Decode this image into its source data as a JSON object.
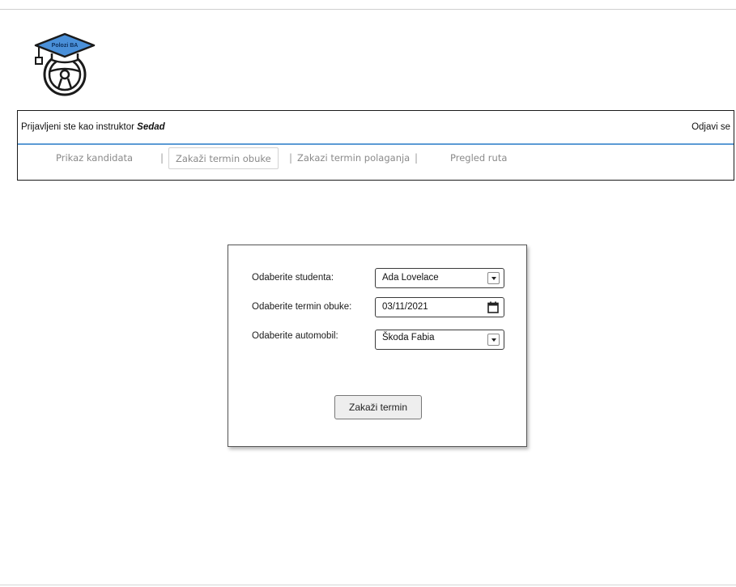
{
  "logo": {
    "badge_text": "Polozi BA",
    "icon": "graduation-cap-steering-wheel-icon"
  },
  "header": {
    "user_prefix": "Prijavljeni ste kao instruktor ",
    "user_name": "Sedad",
    "logout_label": "Odjavi se"
  },
  "nav": {
    "items": [
      {
        "label": "Prikaz kandidata",
        "active": false
      },
      {
        "label": "Zakaži termin obuke",
        "active": true
      },
      {
        "label": "Zakazi termin polaganja",
        "active": false
      },
      {
        "label": "Pregled ruta",
        "active": false
      }
    ],
    "separator": "|"
  },
  "form": {
    "student_label": "Odaberite studenta:",
    "student_value": "Ada Lovelace",
    "date_label": "Odaberite termin obuke:",
    "date_value": "03/11/2021",
    "car_label": "Odaberite automobil:",
    "car_value": "Škoda Fabia",
    "submit_label": "Zakaži termin"
  },
  "colors": {
    "accent_line": "#5b9bd5",
    "cap_blue": "#4a90d9"
  }
}
